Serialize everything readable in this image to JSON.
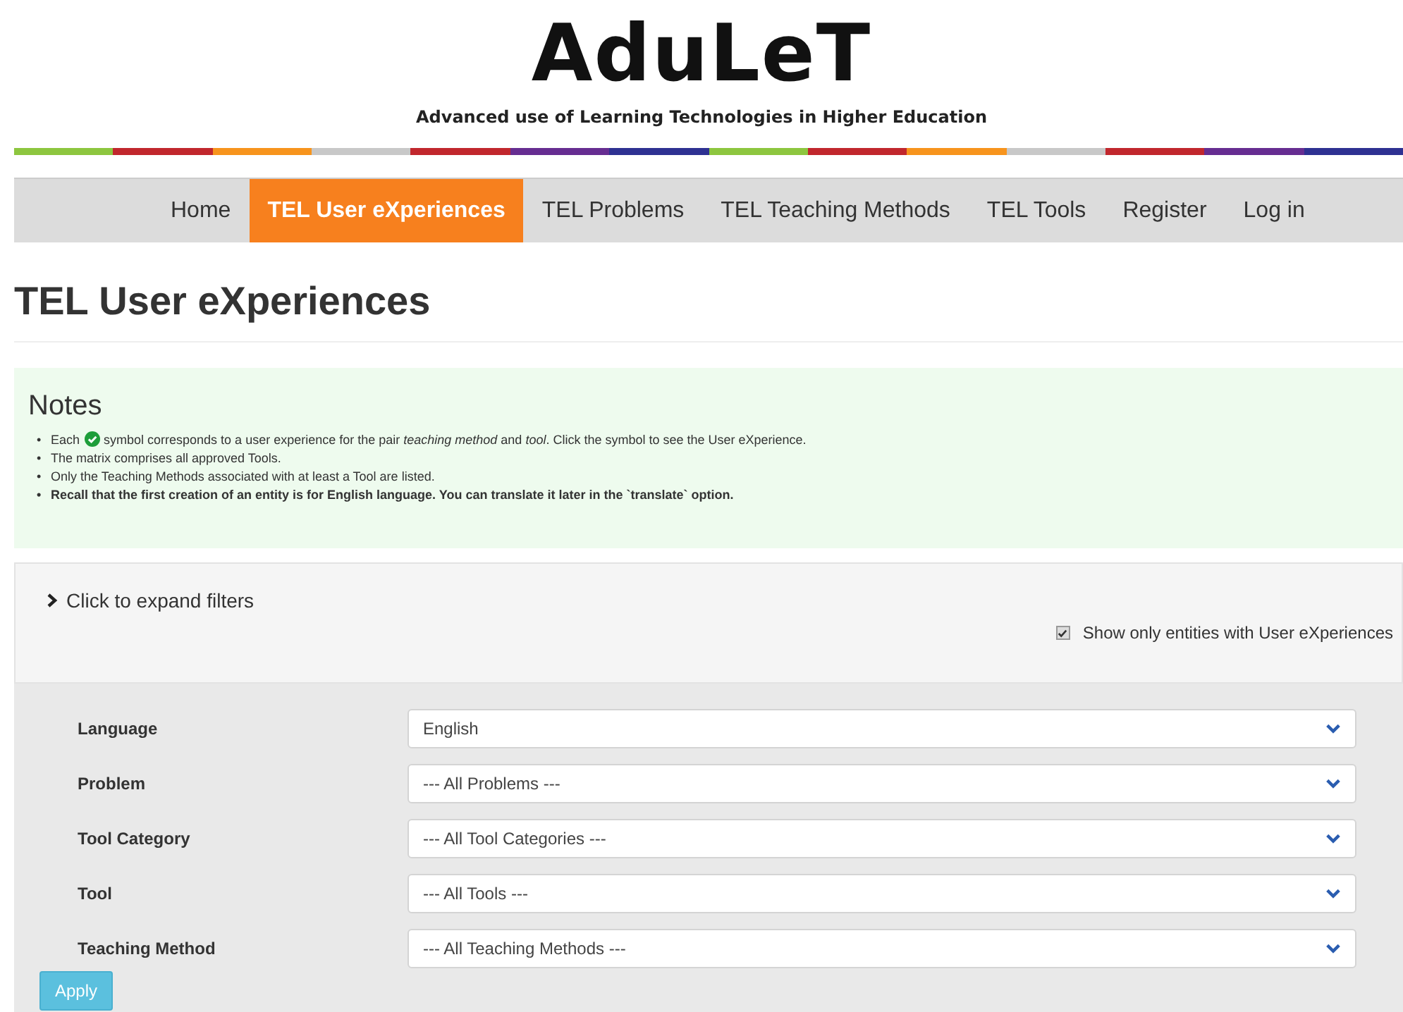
{
  "header": {
    "logo": "AduLeT",
    "tagline": "Advanced use of Learning Technologies in Higher Education"
  },
  "nav": [
    {
      "label": "Home",
      "selected": false
    },
    {
      "label": "TEL User eXperiences",
      "selected": true
    },
    {
      "label": "TEL Problems",
      "selected": false
    },
    {
      "label": "TEL Teaching Methods",
      "selected": false
    },
    {
      "label": "TEL Tools",
      "selected": false
    },
    {
      "label": "Register",
      "selected": false
    },
    {
      "label": "Log in",
      "selected": false
    }
  ],
  "page_title": "TEL User eXperiences",
  "notes": {
    "title": "Notes",
    "items": [
      {
        "marker": "•",
        "text_before": "Each",
        "icon": true,
        "text": "symbol corresponds to a user experience for the pair *teaching method* and *tool*. Click the symbol to see the User eXperience.",
        "emphasis": false
      },
      {
        "marker": "•",
        "text": "The matrix comprises all approved Tools.",
        "emphasis": false
      },
      {
        "marker": "•",
        "text": "Only the Teaching Methods associated with at least a Tool are listed.",
        "emphasis": false
      },
      {
        "marker": "•",
        "text": "Recall that the first creation of an entity is for English language. You can translate it later in the `translate` option.",
        "emphasis": true
      }
    ]
  },
  "filters": {
    "toggle": "Click to expand filters",
    "expanded": false,
    "only_with_ux": {
      "label": "Show only entities with User eXperiences",
      "checked": true
    },
    "fields": [
      {
        "label": "Language",
        "value": "English"
      },
      {
        "label": "Problem",
        "value": "--- All Problems ---"
      },
      {
        "label": "Tool Category",
        "value": "--- All Tool Categories ---"
      },
      {
        "label": "Tool",
        "value": "--- All Tools ---"
      },
      {
        "label": "Teaching Method",
        "value": "--- All Teaching Methods ---"
      }
    ],
    "apply": "Apply"
  }
}
